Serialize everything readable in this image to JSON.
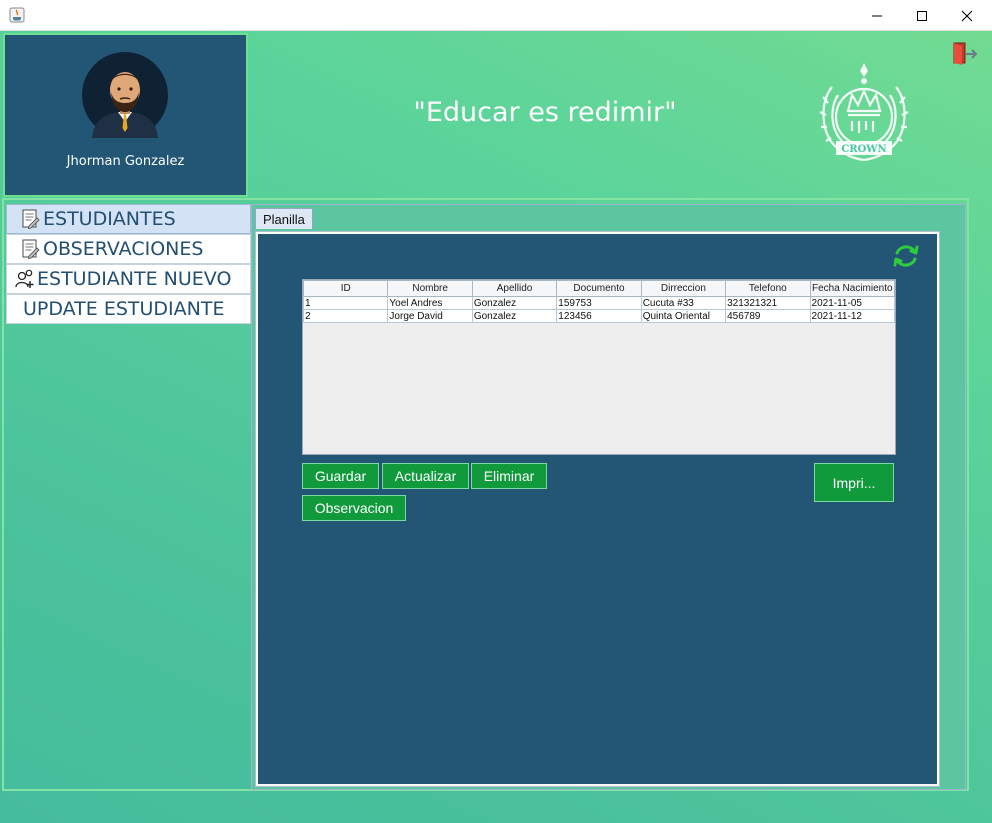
{
  "window": {
    "controls": {
      "minimize": "—",
      "maximize": "☐",
      "close": "✕"
    }
  },
  "profile": {
    "user_name": "Jhorman Gonzalez"
  },
  "header": {
    "motto": "\"Educar es redimir\"",
    "logo_text": "CROWN"
  },
  "sidebar": {
    "tabs": [
      {
        "label": "ESTUDIANTES",
        "icon": "document-edit-icon",
        "selected": true
      },
      {
        "label": "OBSERVACIONES",
        "icon": "document-edit-icon",
        "selected": false
      },
      {
        "label": "ESTUDIANTE NUEVO",
        "icon": "add-user-icon",
        "selected": false
      },
      {
        "label": "UPDATE ESTUDIANTE",
        "icon": "",
        "selected": false
      }
    ]
  },
  "main": {
    "tab_label": "Planilla",
    "table": {
      "columns": [
        "ID",
        "Nombre",
        "Apellido",
        "Documento",
        "Dirreccion",
        "Telefono",
        "Fecha Nacimiento"
      ],
      "rows": [
        [
          "1",
          "Yoel Andres",
          "Gonzalez",
          "159753",
          "Cucuta #33",
          "321321321",
          "2021-11-05"
        ],
        [
          "2",
          "Jorge David",
          "Gonzalez",
          "123456",
          "Quinta Oriental",
          "456789",
          "2021-11-12"
        ]
      ]
    },
    "buttons": {
      "guardar": "Guardar",
      "actualizar": "Actualizar",
      "eliminar": "Eliminar",
      "observacion": "Observacion",
      "imprimir": "Impri..."
    }
  },
  "colors": {
    "panel_dark": "#235574",
    "button_green": "#109a3c",
    "accent_green": "#6fe08d",
    "background_gradient_start": "#72db92",
    "background_gradient_end": "#45bc9c"
  }
}
